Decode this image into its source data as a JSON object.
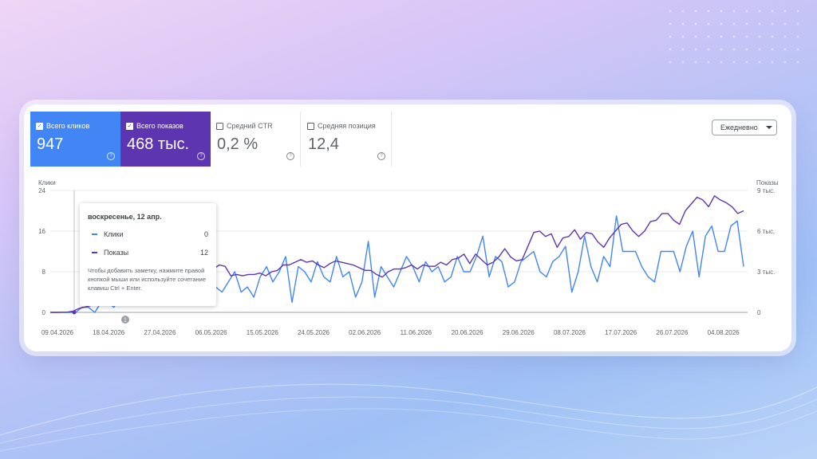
{
  "metrics": {
    "clicks": {
      "label": "Всего кликов",
      "value": "947",
      "checked": true,
      "color": "#4285f4"
    },
    "impressions": {
      "label": "Всего показов",
      "value": "468 тыс.",
      "checked": true,
      "color": "#5e35b1"
    },
    "ctr": {
      "label": "Средний CTR",
      "value": "0,2 %",
      "checked": false
    },
    "position": {
      "label": "Средняя позиция",
      "value": "12,4",
      "checked": false
    }
  },
  "dropdown": {
    "label": "Ежедневно"
  },
  "tooltip": {
    "date": "воскресенье, 12 апр.",
    "rows": [
      {
        "label": "Клики",
        "value": "0",
        "color": "#4285f4"
      },
      {
        "label": "Показы",
        "value": "12",
        "color": "#5e35b1"
      }
    ],
    "note": "Чтобы добавить заметку, нажмите правой кнопкой мыши или используйте сочетание клавиш Ctrl + Enter."
  },
  "annotation_marker": "1",
  "chart_data": {
    "type": "line",
    "y_left_label": "Клики",
    "y_right_label": "Показы",
    "y_left_ticks": [
      "24",
      "16",
      "8",
      "0"
    ],
    "y_left_range": [
      0,
      24
    ],
    "y_right_ticks": [
      "9 тыс.",
      "6 тыс.",
      "3 тыс.",
      "0"
    ],
    "y_right_range": [
      0,
      9000
    ],
    "x_ticks": [
      "09.04.2026",
      "18.04.2026",
      "27.04.2026",
      "06.05.2026",
      "15.05.2026",
      "24.05.2026",
      "02.06.2026",
      "11.06.2026",
      "20.06.2026",
      "29.06.2026",
      "08.07.2026",
      "17.07.2026",
      "26.07.2026",
      "04.08.2026"
    ],
    "grid": true,
    "series": [
      {
        "name": "Клики",
        "axis": "left",
        "color": "#4285f4",
        "values": [
          0,
          0,
          0,
          0,
          0,
          1,
          1,
          0,
          2,
          2,
          1,
          3,
          3,
          5,
          4,
          5,
          6,
          4,
          5,
          6,
          5,
          4,
          3,
          7,
          7,
          6,
          5,
          4,
          6,
          8,
          4,
          5,
          3,
          7,
          9,
          6,
          8,
          11,
          2,
          9,
          8,
          6,
          10,
          7,
          6,
          11,
          7,
          8,
          3,
          6,
          14,
          3,
          9,
          7,
          5,
          8,
          11,
          9,
          6,
          10,
          8,
          9,
          6,
          7,
          11,
          8,
          8,
          11,
          15,
          7,
          11,
          10,
          5,
          6,
          10,
          11,
          12,
          8,
          7,
          10,
          11,
          13,
          4,
          8,
          15,
          9,
          6,
          11,
          9,
          19,
          12,
          12,
          12,
          9,
          7,
          6,
          12,
          12,
          12,
          8,
          13,
          16,
          7,
          15,
          17,
          12,
          12,
          17,
          18,
          9
        ]
      },
      {
        "name": "Показы",
        "axis": "right",
        "color": "#5e35b1",
        "values": [
          0,
          0,
          10,
          20,
          100,
          300,
          400,
          500,
          600,
          700,
          800,
          900,
          1100,
          1300,
          1500,
          1600,
          1800,
          1900,
          2100,
          2200,
          2200,
          2300,
          2200,
          2300,
          2600,
          2900,
          3200,
          3300,
          3200,
          3500,
          3400,
          2700,
          2800,
          2700,
          2800,
          2800,
          2900,
          2700,
          3000,
          3100,
          3500,
          3500,
          3700,
          3900,
          3700,
          3800,
          3500,
          3300,
          3600,
          3800,
          3700,
          3600,
          3500,
          3300,
          3100,
          3100,
          2800,
          2600,
          3000,
          3200,
          3200,
          3300,
          3500,
          3200,
          3500,
          3400,
          3400,
          3700,
          3500,
          3900,
          4000,
          4300,
          3600,
          4300,
          3900,
          3500,
          3700,
          4100,
          4700,
          4100,
          3800,
          3900,
          4900,
          5900,
          6000,
          5600,
          5800,
          4800,
          5500,
          5600,
          6100,
          5400,
          5900,
          5800,
          5200,
          4800,
          5500,
          6000,
          6500,
          6600,
          6000,
          5600,
          6000,
          6700,
          6800,
          7300,
          7300,
          6800,
          6500,
          7500,
          8000,
          8500,
          8300,
          7800,
          8600,
          8300,
          8100,
          7800,
          7300,
          7500
        ]
      }
    ]
  }
}
